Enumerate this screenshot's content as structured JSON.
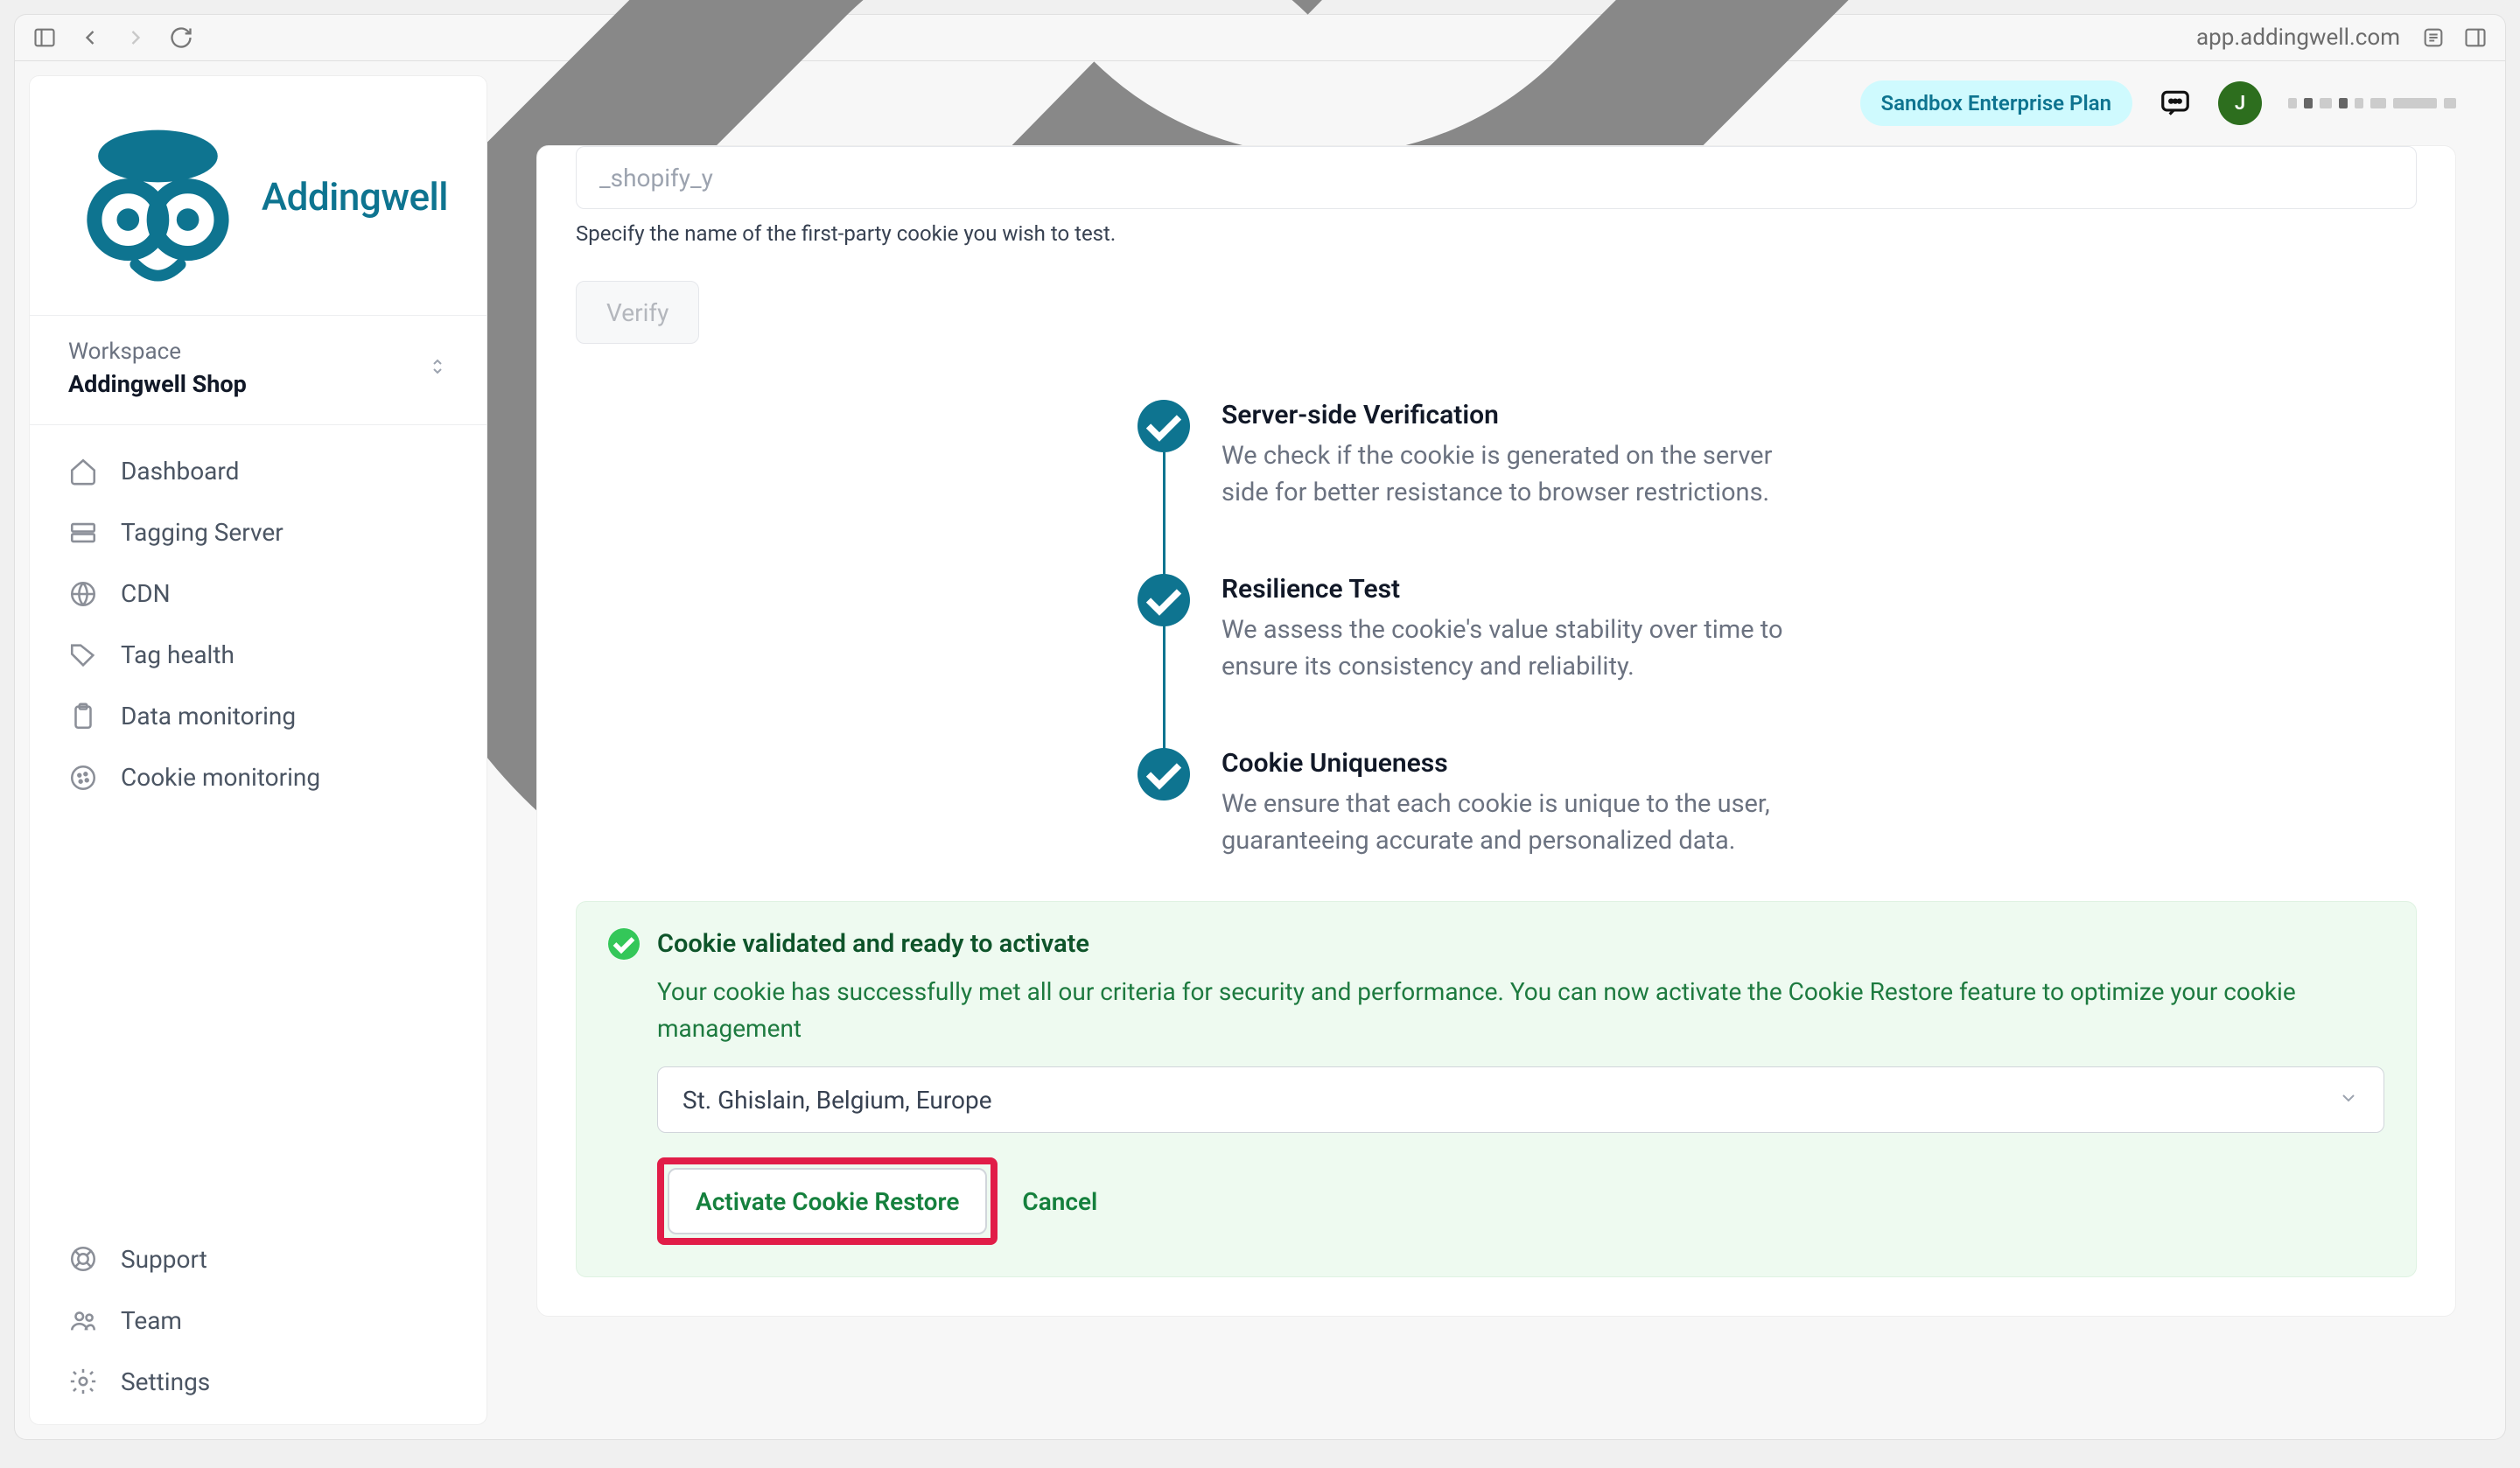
{
  "browser": {
    "url": "app.addingwell.com"
  },
  "brand": {
    "name": "Addingwell",
    "color": "#0e7490"
  },
  "workspace": {
    "label": "Workspace",
    "name": "Addingwell Shop"
  },
  "sidebar": {
    "main": [
      {
        "label": "Dashboard",
        "icon": "home-icon"
      },
      {
        "label": "Tagging Server",
        "icon": "server-icon"
      },
      {
        "label": "CDN",
        "icon": "globe-icon"
      },
      {
        "label": "Tag health",
        "icon": "tag-icon"
      },
      {
        "label": "Data monitoring",
        "icon": "clipboard-icon"
      },
      {
        "label": "Cookie monitoring",
        "icon": "cookie-icon"
      }
    ],
    "bottom": [
      {
        "label": "Support",
        "icon": "lifebuoy-icon"
      },
      {
        "label": "Team",
        "icon": "team-icon"
      },
      {
        "label": "Settings",
        "icon": "gear-icon"
      }
    ]
  },
  "topbar": {
    "plan": "Sandbox Enterprise Plan",
    "avatar_initial": "J"
  },
  "form": {
    "cookie_placeholder": "_shopify_y",
    "helper": "Specify the name of the first-party cookie you wish to test.",
    "verify": "Verify"
  },
  "steps": [
    {
      "title": "Server-side Verification",
      "desc": "We check if the cookie is generated on the server side for better resistance to browser restrictions."
    },
    {
      "title": "Resilience Test",
      "desc": "We assess the cookie's value stability over time to ensure its consistency and reliability."
    },
    {
      "title": "Cookie Uniqueness",
      "desc": "We ensure that each cookie is unique to the user, guaranteeing accurate and personalized data."
    }
  ],
  "success": {
    "title": "Cookie validated and ready to activate",
    "body": "Your cookie has successfully met all our criteria for security and performance. You can now activate the Cookie Restore feature to optimize your cookie management",
    "region": "St. Ghislain, Belgium, Europe",
    "activate": "Activate Cookie Restore",
    "cancel": "Cancel"
  }
}
